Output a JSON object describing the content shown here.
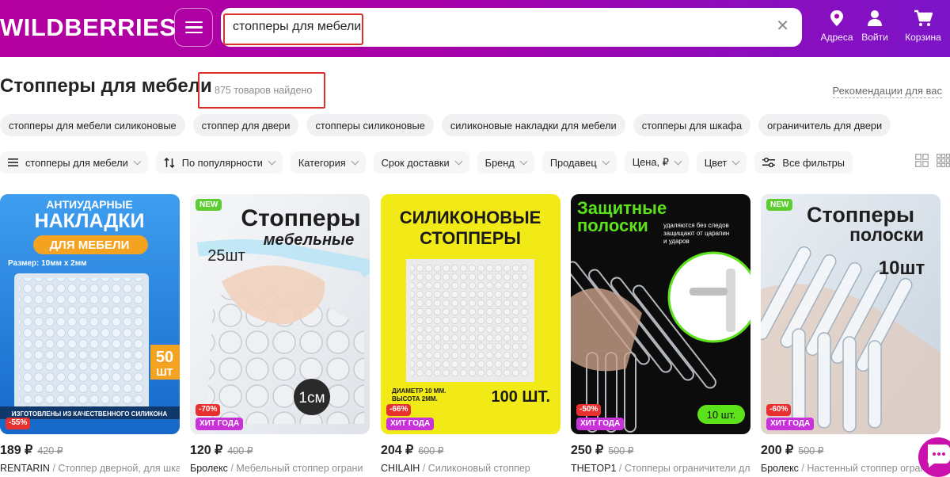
{
  "header": {
    "logo": "WILDBERRIES",
    "search_value": "стопперы для мебели",
    "buttons": [
      {
        "label": "Адреса",
        "icon": "location-pin-icon"
      },
      {
        "label": "Войти",
        "icon": "user-icon"
      },
      {
        "label": "Корзина",
        "icon": "cart-icon"
      }
    ]
  },
  "page": {
    "title": "Стопперы для мебели",
    "found": "875 товаров найдено",
    "recommendations": "Рекомендации для вас"
  },
  "tags": [
    "стопперы для мебели силиконовые",
    "стоппер для двери",
    "стопперы силиконовые",
    "силиконовые накладки для мебели",
    "стопперы для шкафа",
    "ограничитель для двери"
  ],
  "filters": {
    "query": "стопперы для мебели",
    "sort": "По популярности",
    "items": [
      "Категория",
      "Срок доставки",
      "Бренд",
      "Продавец",
      "Цена, ₽",
      "Цвет"
    ],
    "all": "Все фильтры"
  },
  "products": [
    {
      "price": "189 ₽",
      "old_price": "420 ₽",
      "discount": "-55%",
      "hit": "",
      "new": "",
      "brand": "RENTARIN",
      "desc": "Стоппер дверной, для шкаф",
      "img": {
        "line1": "АНТИУДАРНЫЕ",
        "line2": "НАКЛАДКИ",
        "line3": "ДЛЯ МЕБЕЛИ",
        "size": "Размер: 10мм x 2мм",
        "count": "50",
        "unit": "ШТ",
        "footer": "ИЗГОТОВЛЕНЫ ИЗ КАЧЕСТВЕННОГО СИЛИКОНА"
      }
    },
    {
      "price": "120 ₽",
      "old_price": "400 ₽",
      "discount": "-70%",
      "hit": "ХИТ ГОДА",
      "new": "NEW",
      "brand": "Бролекс",
      "desc": "Мебельный стоппер ограни",
      "img": {
        "line1": "Стопперы",
        "line2": "мебельные",
        "count": "25шт",
        "size": "1см"
      }
    },
    {
      "price": "204 ₽",
      "old_price": "600 ₽",
      "discount": "-66%",
      "hit": "ХИТ ГОДА",
      "new": "",
      "brand": "CHILAIH",
      "desc": "Силиконовый стоппер",
      "img": {
        "line1": "СИЛИКОНОВЫЕ",
        "line2": "СТОППЕРЫ",
        "dims1": "ДИАМЕТР 10 ММ.",
        "dims2": "ВЫСОТА 2ММ.",
        "count": "100 ШТ."
      }
    },
    {
      "price": "250 ₽",
      "old_price": "500 ₽",
      "discount": "-50%",
      "hit": "ХИТ ГОДА",
      "new": "",
      "brand": "THETOP1",
      "desc": "Стопперы ограничители для",
      "img": {
        "line1": "Защитные",
        "line2": "полоски",
        "note1": "удаляются без следов",
        "note2": "защищают от царапин",
        "note3": "и ударов",
        "count": "10 шт."
      }
    },
    {
      "price": "200 ₽",
      "old_price": "500 ₽",
      "discount": "-60%",
      "hit": "ХИТ ГОДА",
      "new": "NEW",
      "brand": "Бролекс",
      "desc": "Настенный стоппер ограни",
      "img": {
        "line1": "Стопперы",
        "line2": "полоски",
        "count": "10шт"
      }
    }
  ],
  "colors": {
    "brand": "#b4009f",
    "discount": "#e8312e",
    "hit": "#c931d9",
    "new": "#5ccc30"
  }
}
